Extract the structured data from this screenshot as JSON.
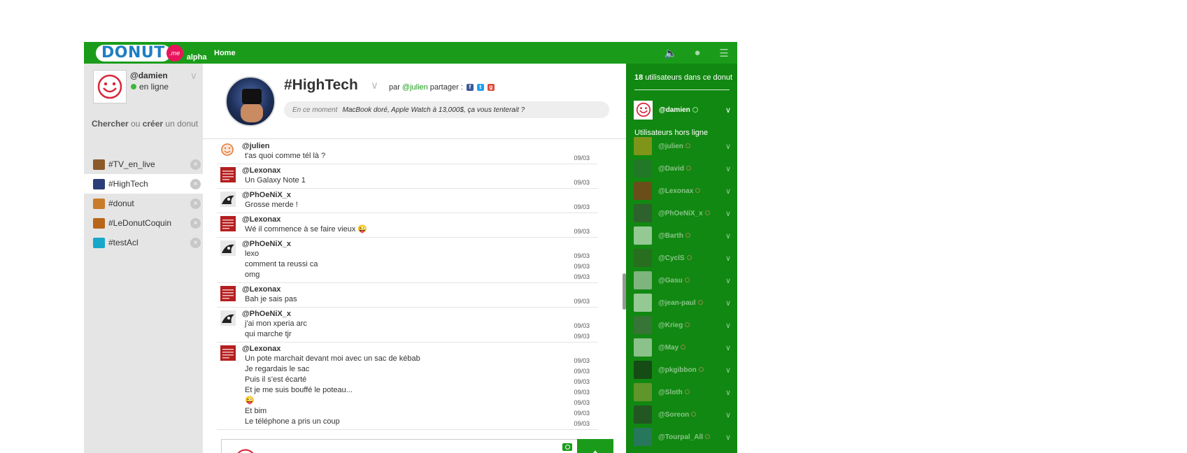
{
  "topbar": {
    "logo_text": "DONUT",
    "logo_badge": ".me",
    "alpha": "alpha",
    "home": "Home",
    "icons": [
      "volume-icon",
      "globe-icon",
      "menu-icon"
    ],
    "bg_color": "#1a9c1a"
  },
  "me": {
    "name": "@damien",
    "status": "en ligne"
  },
  "search": {
    "part1": "Chercher",
    "part2": " ou ",
    "part3": "créer",
    "part4": " un donut"
  },
  "donuts": [
    {
      "label": "#TV_en_live",
      "color": "#8b5a2b"
    },
    {
      "label": "#HighTech",
      "color": "#2c3e78"
    },
    {
      "label": "#donut",
      "color": "#c87c2a"
    },
    {
      "label": "#LeDonutCoquin",
      "color": "#b8651a"
    },
    {
      "label": "#testAcl",
      "color": "#19a7c9"
    }
  ],
  "room": {
    "title": "#HighTech",
    "by_prefix": "par",
    "author": "@julien",
    "share_label": "partager :",
    "topic_label": "En ce moment",
    "topic_text": "MacBook doré, Apple Watch à 13,000$, ça vous tenterait ?"
  },
  "messages": [
    {
      "author": "@julien",
      "avatar": "julien",
      "lines": [
        {
          "text": "t'as quoi comme tél là ?",
          "date": "09/03"
        }
      ]
    },
    {
      "author": "@Lexonax",
      "avatar": "lexonax",
      "lines": [
        {
          "text": "Un Galaxy Note 1",
          "date": "09/03"
        }
      ]
    },
    {
      "author": "@PhOeNiX_x",
      "avatar": "phoenix",
      "lines": [
        {
          "text": "Grosse merde !",
          "date": "09/03"
        }
      ]
    },
    {
      "author": "@Lexonax",
      "avatar": "lexonax",
      "lines": [
        {
          "text": "Wé il commence à se faire vieux 😜",
          "date": "09/03"
        }
      ]
    },
    {
      "author": "@PhOeNiX_x",
      "avatar": "phoenix",
      "lines": [
        {
          "text": "lexo",
          "date": "09/03"
        },
        {
          "text": "comment ta reussi ca",
          "date": "09/03"
        },
        {
          "text": "omg",
          "date": "09/03"
        }
      ]
    },
    {
      "author": "@Lexonax",
      "avatar": "lexonax",
      "lines": [
        {
          "text": "Bah je sais pas",
          "date": "09/03"
        }
      ]
    },
    {
      "author": "@PhOeNiX_x",
      "avatar": "phoenix",
      "lines": [
        {
          "text": "j'ai mon xperia arc",
          "date": "09/03"
        },
        {
          "text": "qui marche tjr",
          "date": "09/03"
        }
      ]
    },
    {
      "author": "@Lexonax",
      "avatar": "lexonax",
      "lines": [
        {
          "text": "Un pote marchait devant moi avec un sac de kébab",
          "date": "09/03"
        },
        {
          "text": "Je regardais le sac",
          "date": "09/03"
        },
        {
          "text": "Puis il s'est écarté",
          "date": "09/03"
        },
        {
          "text": "Et je me suis bouffé le poteau...",
          "date": "09/03"
        },
        {
          "text": "😜",
          "date": "09/03"
        },
        {
          "text": "Et bim",
          "date": "09/03"
        },
        {
          "text": "Le téléphone a pris un coup",
          "date": "09/03"
        }
      ]
    }
  ],
  "right": {
    "count": "18",
    "count_label": "utilisateurs dans ce donut",
    "me_name": "@damien",
    "offline_title": "Utilisateurs hors ligne",
    "offline": [
      {
        "name": "@julien",
        "color": "#d9a020"
      },
      {
        "name": "@David",
        "color": "#2f6b3a"
      },
      {
        "name": "@Lexonax",
        "color": "#b32020"
      },
      {
        "name": "@PhOeNiX_x",
        "color": "#444444"
      },
      {
        "name": "@Barth",
        "color": "#ffffff"
      },
      {
        "name": "@CyclS",
        "color": "#3a5a2a"
      },
      {
        "name": "@Gasu",
        "color": "#d8d8d8"
      },
      {
        "name": "@jean-paul",
        "color": "#ffffff"
      },
      {
        "name": "@Krieg",
        "color": "#556655"
      },
      {
        "name": "@May",
        "color": "#f0f0f0"
      },
      {
        "name": "@pkgibbon",
        "color": "#1a1a1a"
      },
      {
        "name": "@Sloth",
        "color": "#a0a040"
      },
      {
        "name": "@Soreon",
        "color": "#303030"
      },
      {
        "name": "@Tourpal_All",
        "color": "#3a6a9a"
      }
    ]
  }
}
